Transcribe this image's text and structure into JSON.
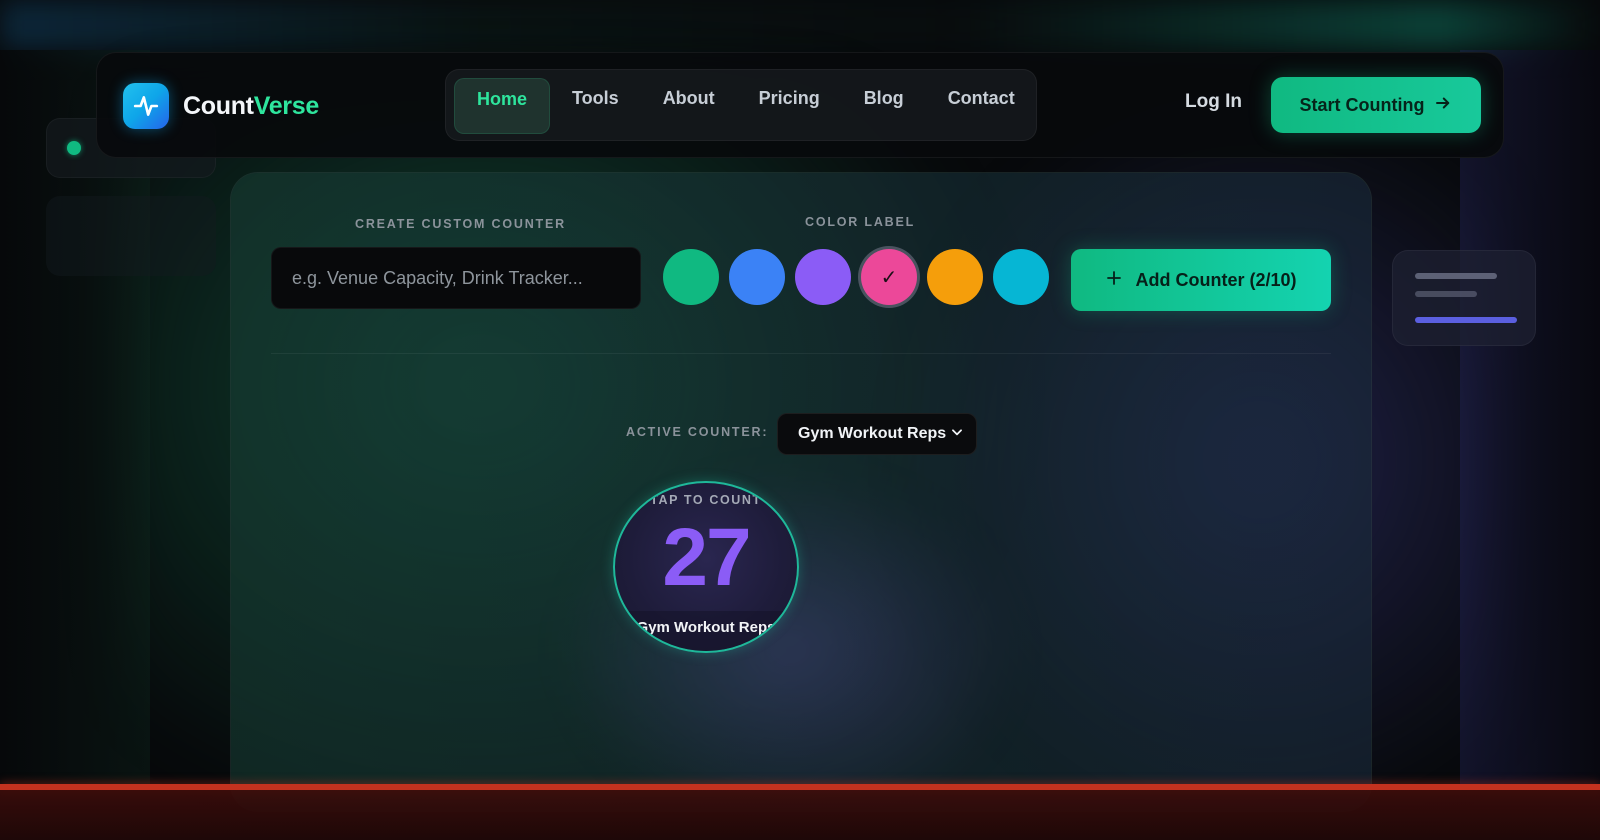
{
  "brand": {
    "name_part1": "Count",
    "name_part2": "Verse",
    "icon": "pulse-icon"
  },
  "nav": {
    "links": [
      "Home",
      "Tools",
      "About",
      "Pricing",
      "Blog",
      "Contact"
    ],
    "active": "Home",
    "login_label": "Log In",
    "cta_label": "Start Counting",
    "cta_icon": "arrow-right-icon"
  },
  "create": {
    "label": "CREATE CUSTOM COUNTER",
    "input_placeholder": "e.g. Venue Capacity, Drink Tracker...",
    "input_value": "",
    "color_label": "COLOR LABEL",
    "colors": [
      "#10b981",
      "#3b82f6",
      "#8b5cf6",
      "#ec4899",
      "#f59e0b",
      "#06b6d4"
    ],
    "selected_color": "#ec4899",
    "check_glyph": "✓",
    "add_button_icon": "plus-icon",
    "add_button_label": "Add Counter (2/10)"
  },
  "active": {
    "label": "ACTIVE COUNTER:",
    "selected": "Gym Workout Reps",
    "chevron": "chevron-down-icon"
  },
  "counter": {
    "tap_text": "TAP TO COUNT",
    "value": "27",
    "name": "Gym Workout Reps",
    "value_color": "#8b5cf6"
  },
  "theme": {
    "accent": "#10b981",
    "accent_text": "#2ee59d"
  }
}
